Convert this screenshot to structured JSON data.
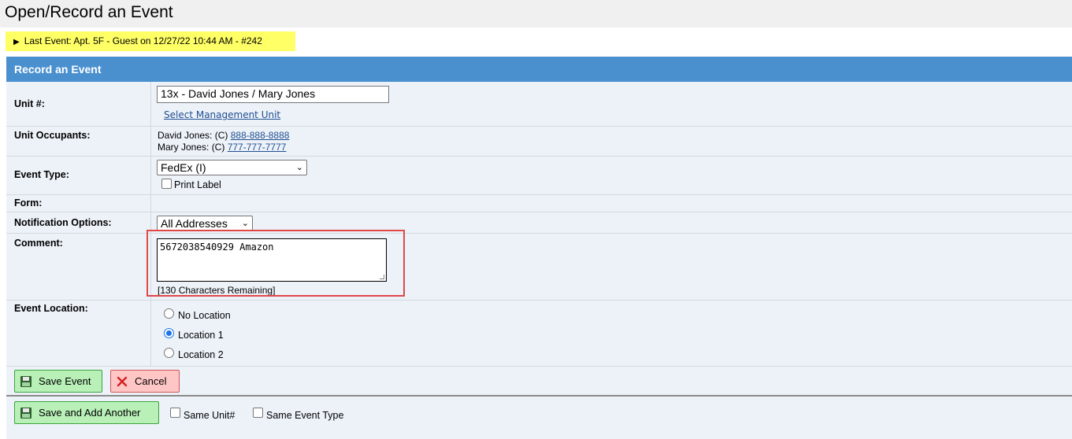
{
  "page": {
    "title": "Open/Record an Event"
  },
  "last_event": {
    "text": "Last Event: Apt. 5F - Guest on 12/27/22 10:44 AM - #242"
  },
  "panel": {
    "title": "Record an Event"
  },
  "form": {
    "unit": {
      "label": "Unit #:",
      "value": "13x - David Jones / Mary Jones",
      "link": "Select Management Unit"
    },
    "occupants": {
      "label": "Unit Occupants:",
      "items": [
        {
          "name": "David Jones: (C)",
          "phone": "888-888-8888"
        },
        {
          "name": "Mary Jones: (C)",
          "phone": "777-777-7777"
        }
      ]
    },
    "event_type": {
      "label": "Event Type:",
      "value": "FedEx (I)",
      "print_label": "Print Label"
    },
    "form_row": {
      "label": "Form:"
    },
    "notification": {
      "label": "Notification Options:",
      "value": "All Addresses"
    },
    "comment": {
      "label": "Comment:",
      "value": "5672038540929 Amazon",
      "remaining": "[130 Characters Remaining]"
    },
    "location": {
      "label": "Event Location:",
      "options": [
        "No Location",
        "Location 1",
        "Location 2"
      ],
      "selected": "Location 1"
    }
  },
  "buttons": {
    "save": "Save Event",
    "cancel": "Cancel",
    "save_add": "Save and Add Another",
    "same_unit": "Same Unit#",
    "same_event_type": "Same Event Type"
  },
  "colors": {
    "header": "#4a90cf",
    "highlight": "#ffff66",
    "annotation": "#e04848"
  }
}
